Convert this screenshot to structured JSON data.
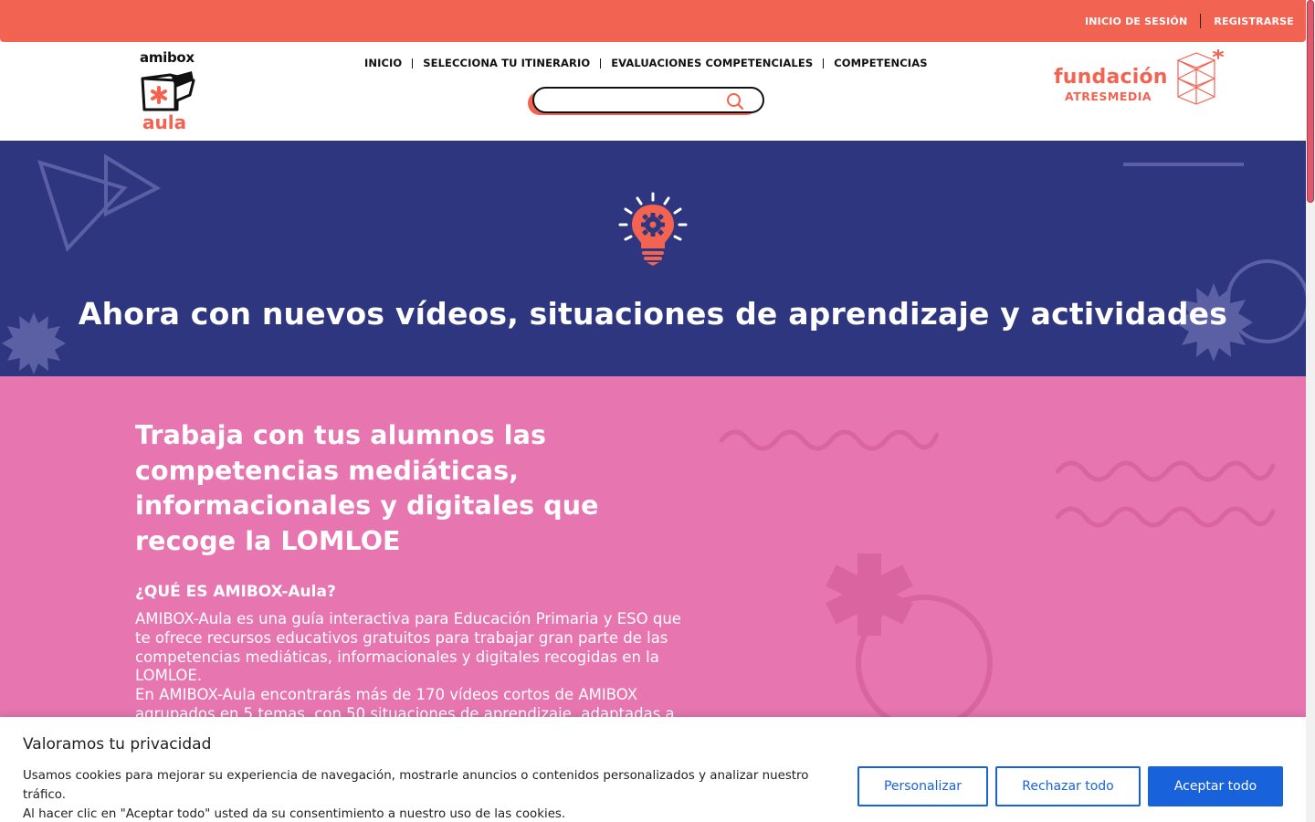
{
  "topbar": {
    "login_label": "INICIO DE SESIÓN",
    "register_label": "REGISTRARSE"
  },
  "header": {
    "logo": {
      "top": "amibox",
      "bottom": "aula"
    },
    "nav": [
      {
        "label": "INICIO"
      },
      {
        "label": "SELECCIONA TU ITINERARIO"
      },
      {
        "label": "EVALUACIONES COMPETENCIALES"
      },
      {
        "label": "COMPETENCIAS"
      }
    ],
    "search": {
      "placeholder": "",
      "value": ""
    },
    "partner_logo": {
      "line1": "fundación",
      "line2": "ATRESMEDIA"
    }
  },
  "hero": {
    "icon": "lightbulb-gear-icon",
    "title": "Ahora con nuevos vídeos, situaciones de aprendizaje y actividades"
  },
  "intro": {
    "heading": "Trabaja con tus alumnos las competencias mediáticas, informacionales y digitales que recoge la LOMLOE",
    "subheading": "¿QUÉ ES AMIBOX-Aula?",
    "paragraph1": "AMIBOX-Aula es una guía interactiva para Educación Primaria y ESO que te ofrece recursos educativos gratuitos para trabajar gran parte de las competencias mediáticas, informacionales y digitales recogidas en la LOMLOE.",
    "paragraph2": "En AMIBOX-Aula encontrarás más de 170 vídeos cortos de AMIBOX agrupados en 5 temas, con 50 situaciones de aprendizaje, adaptadas a"
  },
  "cookie_banner": {
    "title": "Valoramos tu privacidad",
    "line1": "Usamos cookies para mejorar su experiencia de navegación, mostrarle anuncios o contenidos personalizados y analizar nuestro tráfico.",
    "line2": "Al hacer clic en \"Aceptar todo\" usted da su consentimiento a nuestro uso de las cookies.",
    "customize_label": "Personalizar",
    "reject_label": "Rechazar todo",
    "accept_label": "Aceptar todo"
  },
  "colors": {
    "coral": "#f26352",
    "navy": "#2f3680",
    "pink": "#e775b0",
    "button_blue": "#1863dc"
  }
}
